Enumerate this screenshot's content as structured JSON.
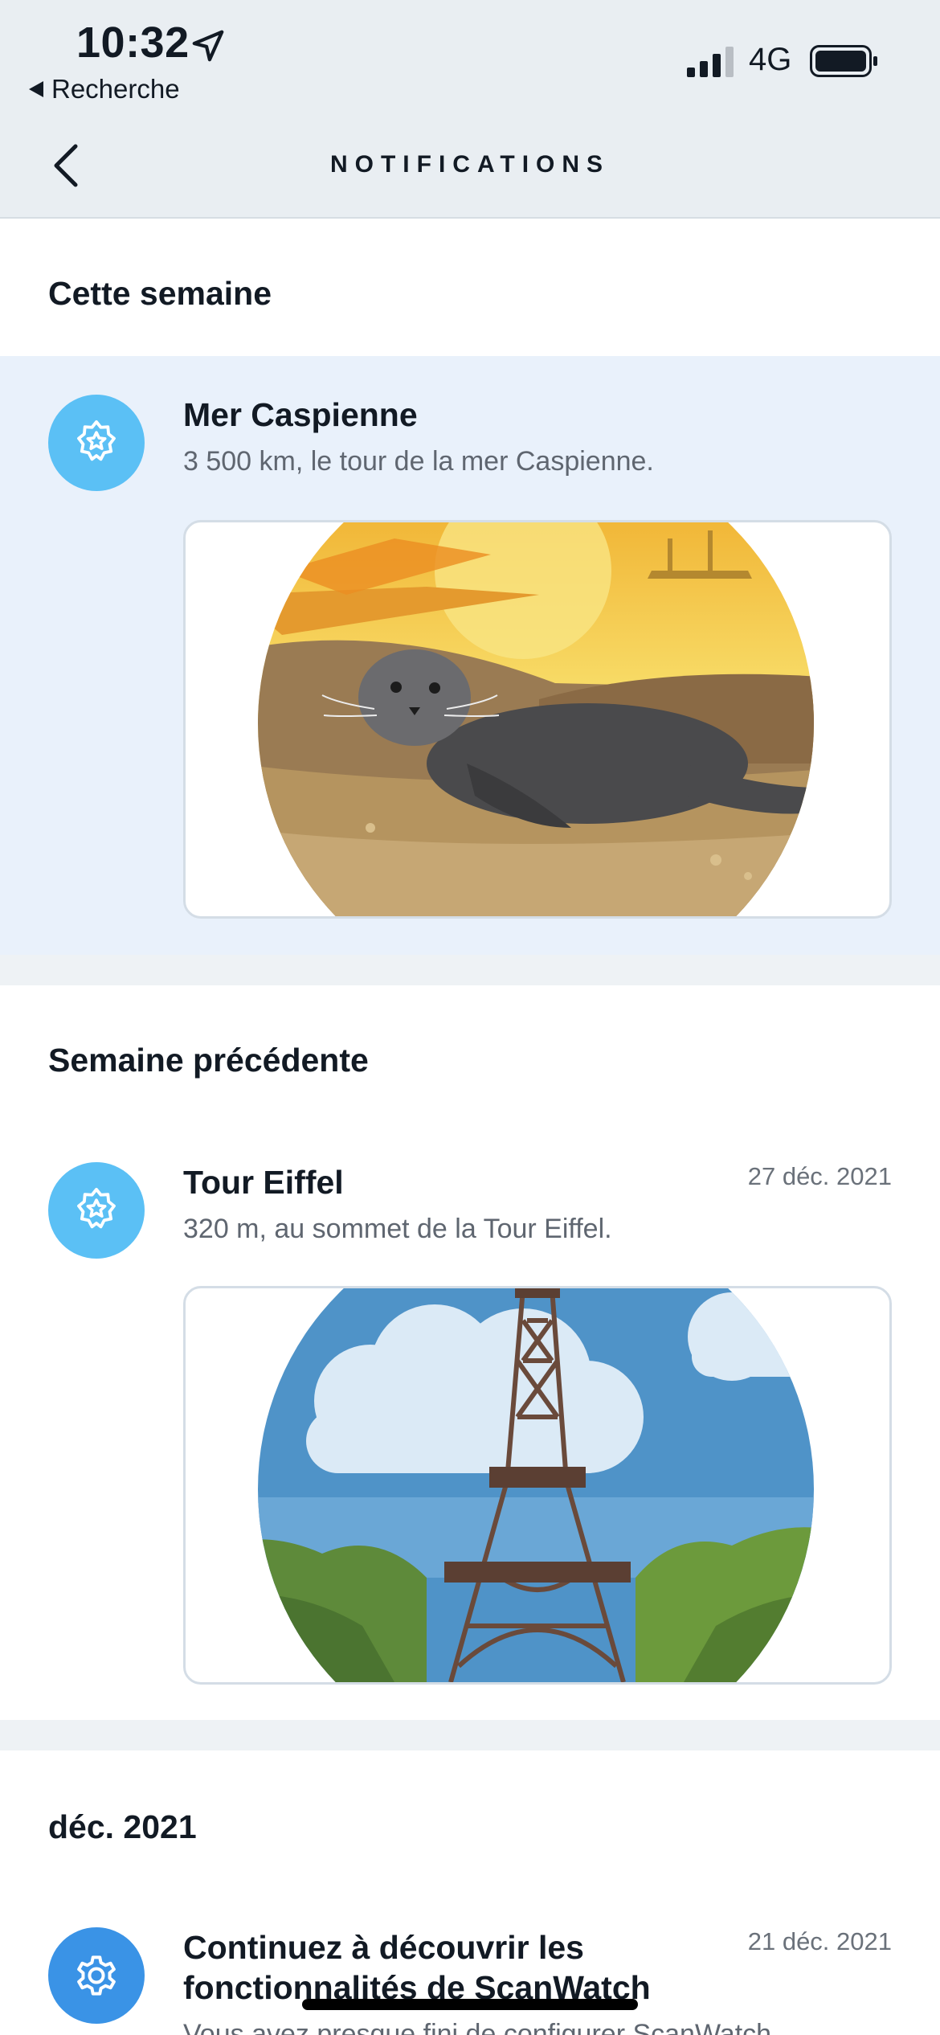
{
  "status_bar": {
    "time": "10:32",
    "back_app": "Recherche",
    "network": "4G"
  },
  "nav": {
    "title": "NOTIFICATIONS"
  },
  "sections": [
    {
      "heading": "Cette semaine",
      "items": [
        {
          "title": "Mer Caspienne",
          "subtitle": "3 500 km, le tour de la mer Caspienne.",
          "date": "",
          "icon": "star-badge-icon",
          "image": "caspian-seal-illustration"
        }
      ]
    },
    {
      "heading": "Semaine précédente",
      "items": [
        {
          "title": "Tour Eiffel",
          "subtitle": "320 m, au sommet de la Tour Eiffel.",
          "date": "27 déc. 2021",
          "icon": "star-badge-icon",
          "image": "eiffel-tower-illustration"
        }
      ]
    },
    {
      "heading": "déc. 2021",
      "items": [
        {
          "title_line1": "Continuez à découvrir les",
          "title_line2": "fonctionnalités de ScanWatch",
          "subtitle": "Vous avez presque fini de configurer ScanWatch",
          "date": "21 déc. 2021",
          "icon": "gear-icon"
        }
      ]
    }
  ],
  "colors": {
    "header_bg": "#e9eef2",
    "highlight_bg": "#e9f1fb",
    "badge_light": "#5bc0f5",
    "badge_dark": "#3a93e6"
  }
}
